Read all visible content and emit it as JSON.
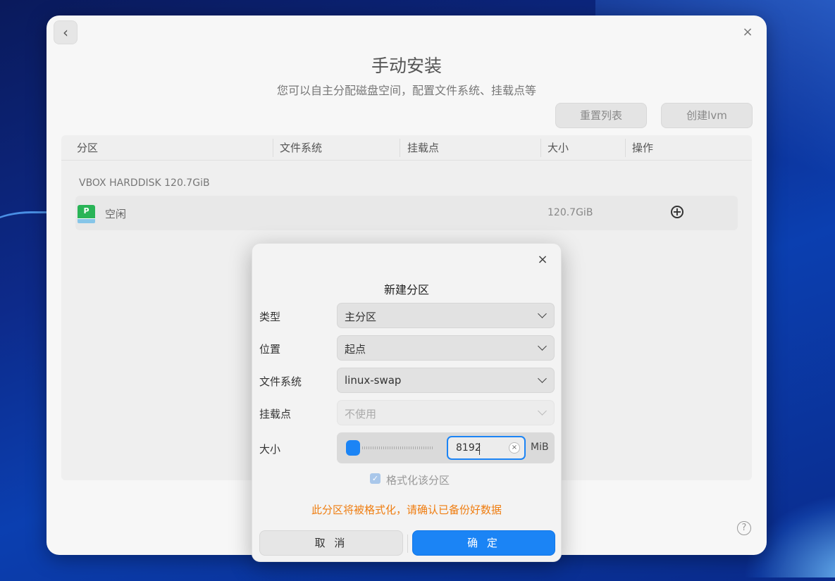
{
  "window": {
    "title": "手动安装",
    "subtitle": "您可以自主分配磁盘空间，配置文件系统、挂载点等",
    "toolbar": {
      "reset_label": "重置列表",
      "lvm_label": "创建lvm"
    }
  },
  "table": {
    "columns": [
      "分区",
      "文件系统",
      "挂载点",
      "大小",
      "操作"
    ],
    "disk_label": "VBOX HARDDISK  120.7GiB",
    "rows": [
      {
        "icon": "partition-icon",
        "icon_letter": "P",
        "name": "空闲",
        "size": "120.7GiB",
        "action_icon": "add-circle-icon"
      }
    ]
  },
  "dialog": {
    "title": "新建分区",
    "fields": {
      "type": {
        "label": "类型",
        "value": "主分区"
      },
      "location": {
        "label": "位置",
        "value": "起点"
      },
      "filesystem": {
        "label": "文件系统",
        "value": "linux-swap"
      },
      "mountpoint": {
        "label": "挂载点",
        "value": "不使用",
        "disabled": true
      },
      "size": {
        "label": "大小",
        "value": "8192",
        "unit": "MiB",
        "slider_fraction": 0.07
      }
    },
    "format_checkbox": {
      "label": "格式化该分区",
      "checked": true,
      "disabled": true
    },
    "warning": "此分区将被格式化，请确认已备份好数据",
    "cancel_label": "取 消",
    "ok_label": "确 定"
  },
  "colors": {
    "accent": "#1b84f5",
    "warning": "#ef7d10",
    "partition_green": "#29b457"
  }
}
